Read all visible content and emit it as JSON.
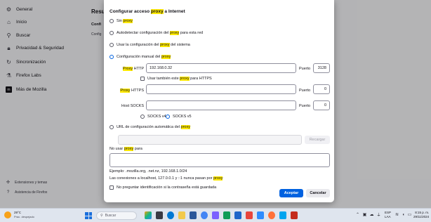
{
  "sidebar": {
    "items": [
      {
        "label": "General",
        "icon": "gear-icon"
      },
      {
        "label": "Inicio",
        "icon": "home-icon"
      },
      {
        "label": "Buscar",
        "icon": "search-icon"
      },
      {
        "label": "Privacidad & Seguridad",
        "icon": "lock-icon"
      },
      {
        "label": "Sincronización",
        "icon": "sync-icon"
      },
      {
        "label": "Firefox Labs",
        "icon": "labs-icon"
      },
      {
        "label": "Más de Mozilla",
        "icon": "mozilla-icon"
      }
    ],
    "footer": [
      {
        "label": "Extensiones y temas",
        "icon": "puzzle-icon"
      },
      {
        "label": "Asistencia de Firefox",
        "icon": "help-icon"
      }
    ]
  },
  "background": {
    "heading_fragment": "Resu",
    "sub1_fragment": "Confi",
    "sub2_fragment": "Config"
  },
  "dialog": {
    "title_pre": "Configurar acceso ",
    "title_hl": "proxy",
    "title_post": " a Internet",
    "options": {
      "none_pre": "Sin ",
      "none_hl": "proxy",
      "auto_pre": "Autodetectar configuración del ",
      "auto_hl": "proxy",
      "auto_post": " para esta red",
      "system_pre": "Usar la configuración del ",
      "system_hl": "proxy",
      "system_post": " del sistema",
      "manual_pre": "Configuración manual del ",
      "manual_hl": "proxy"
    },
    "http": {
      "label_hl": "Proxy",
      "label_post": " HTTP",
      "value": "192.168.0.32",
      "port_label": "Puerto",
      "port_value": "3128"
    },
    "https_checkbox": {
      "pre": "Usar también este ",
      "hl": "proxy",
      "post": " para HTTPS"
    },
    "https": {
      "label_hl": "Proxy",
      "label_post": " HTTPS",
      "value": "",
      "port_label": "Puerto",
      "port_value": "0"
    },
    "socks": {
      "label": "Host SOCKS",
      "value": "",
      "port_label": "Puerto",
      "port_value": "0",
      "v4": "SOCKS v4",
      "v5": "SOCKS v5"
    },
    "pac": {
      "pre": "URL de configuración automática del ",
      "hl": "proxy",
      "value": "",
      "reload": "Recargar"
    },
    "no_proxy": {
      "pre": "No usar ",
      "hl": "proxy",
      "post": " para",
      "value": ""
    },
    "example": "Ejemplo: .mozilla.org, .net.nz, 192.168.1.0/24",
    "localhost_pre": "Las conexiones a localhost, 127.0.0.1 y ::1 nunca pasan por ",
    "localhost_hl": "proxy",
    "auth_check": "No preguntar identificación si la contraseña está guardada",
    "ok": "Aceptar",
    "cancel": "Cancelar"
  },
  "taskbar": {
    "weather_temp": "29°C",
    "weather_desc": "Prac. despejado",
    "search": "Buscar",
    "lang1": "ESP",
    "lang2": "LAA",
    "time": "8:15 p. m.",
    "date": "29/11/2024"
  },
  "colors": {
    "accent": "#0061e0",
    "highlight": "#ffe900"
  }
}
